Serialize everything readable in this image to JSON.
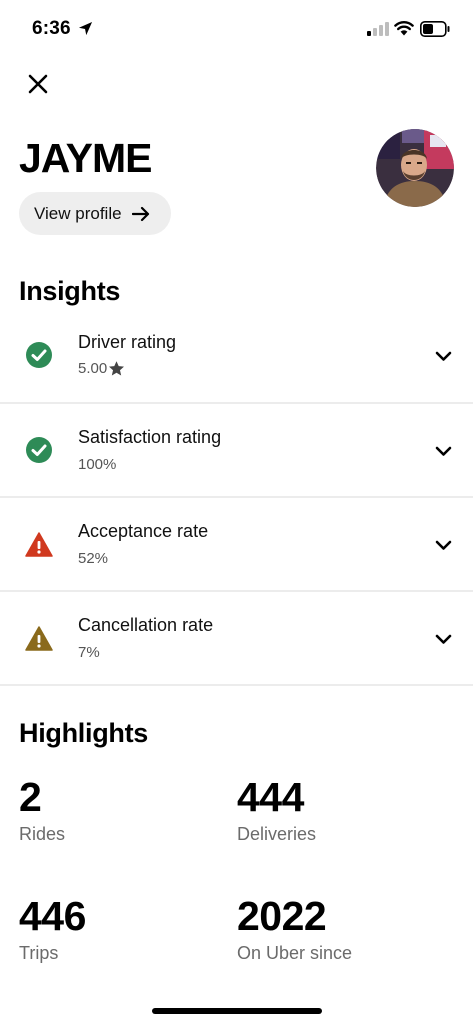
{
  "status_bar": {
    "time": "6:36"
  },
  "header": {
    "driver_name": "JAYME",
    "view_profile_label": "View profile"
  },
  "insights": {
    "title": "Insights",
    "items": [
      {
        "title": "Driver rating",
        "value": "5.00",
        "status": "good",
        "color": "#2e8b57",
        "icon": "check-circle-icon"
      },
      {
        "title": "Satisfaction rating",
        "value": "100%",
        "status": "good",
        "color": "#2e8b57",
        "icon": "check-circle-icon"
      },
      {
        "title": "Acceptance rate",
        "value": "52%",
        "status": "alert",
        "color": "#d0391f",
        "icon": "warning-triangle-icon"
      },
      {
        "title": "Cancellation rate",
        "value": "7%",
        "status": "warning",
        "color": "#8a6a1c",
        "icon": "warning-triangle-icon"
      }
    ]
  },
  "highlights": {
    "title": "Highlights",
    "items": [
      {
        "value": "2",
        "label": "Rides"
      },
      {
        "value": "444",
        "label": "Deliveries"
      },
      {
        "value": "446",
        "label": "Trips"
      },
      {
        "value": "2022",
        "label": "On Uber since"
      }
    ]
  }
}
